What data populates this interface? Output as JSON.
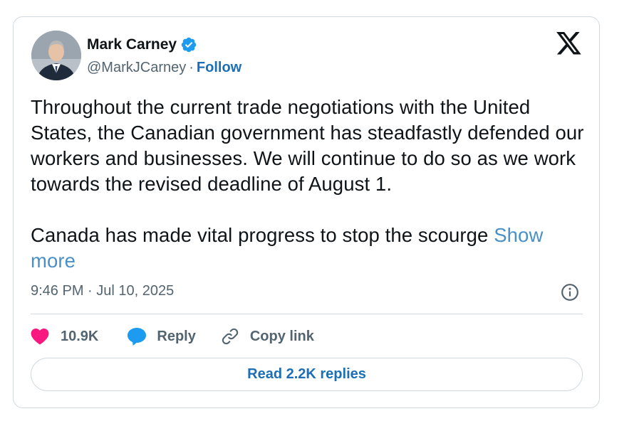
{
  "author": {
    "name": "Mark Carney",
    "handle": "@MarkJCarney",
    "separator": "·",
    "follow_label": "Follow",
    "verified": true
  },
  "tweet": {
    "paragraph1": "Throughout the current trade negotiations with the United States, the Canadian government has steadfastly defended our workers and businesses. We will continue to do so as we work towards the revised deadline of August 1.",
    "paragraph2": "Canada has made vital progress to stop the scourge",
    "show_more_label": "Show more",
    "timestamp": "9:46 PM · Jul 10, 2025"
  },
  "actions": {
    "like_count": "10.9K",
    "reply_label": "Reply",
    "copy_link_label": "Copy link"
  },
  "read_replies_label": "Read 2.2K replies",
  "icons": {
    "brand": "x-logo-icon",
    "verified": "verified-badge-icon",
    "info": "info-icon",
    "like": "heart-icon",
    "reply": "speech-bubble-icon",
    "copy": "link-icon"
  },
  "colors": {
    "accent_blue": "#1d6fb5",
    "verified_blue": "#1d9bf0",
    "like_pink": "#f91880",
    "muted_text": "#536471",
    "border": "#cfd9de"
  }
}
